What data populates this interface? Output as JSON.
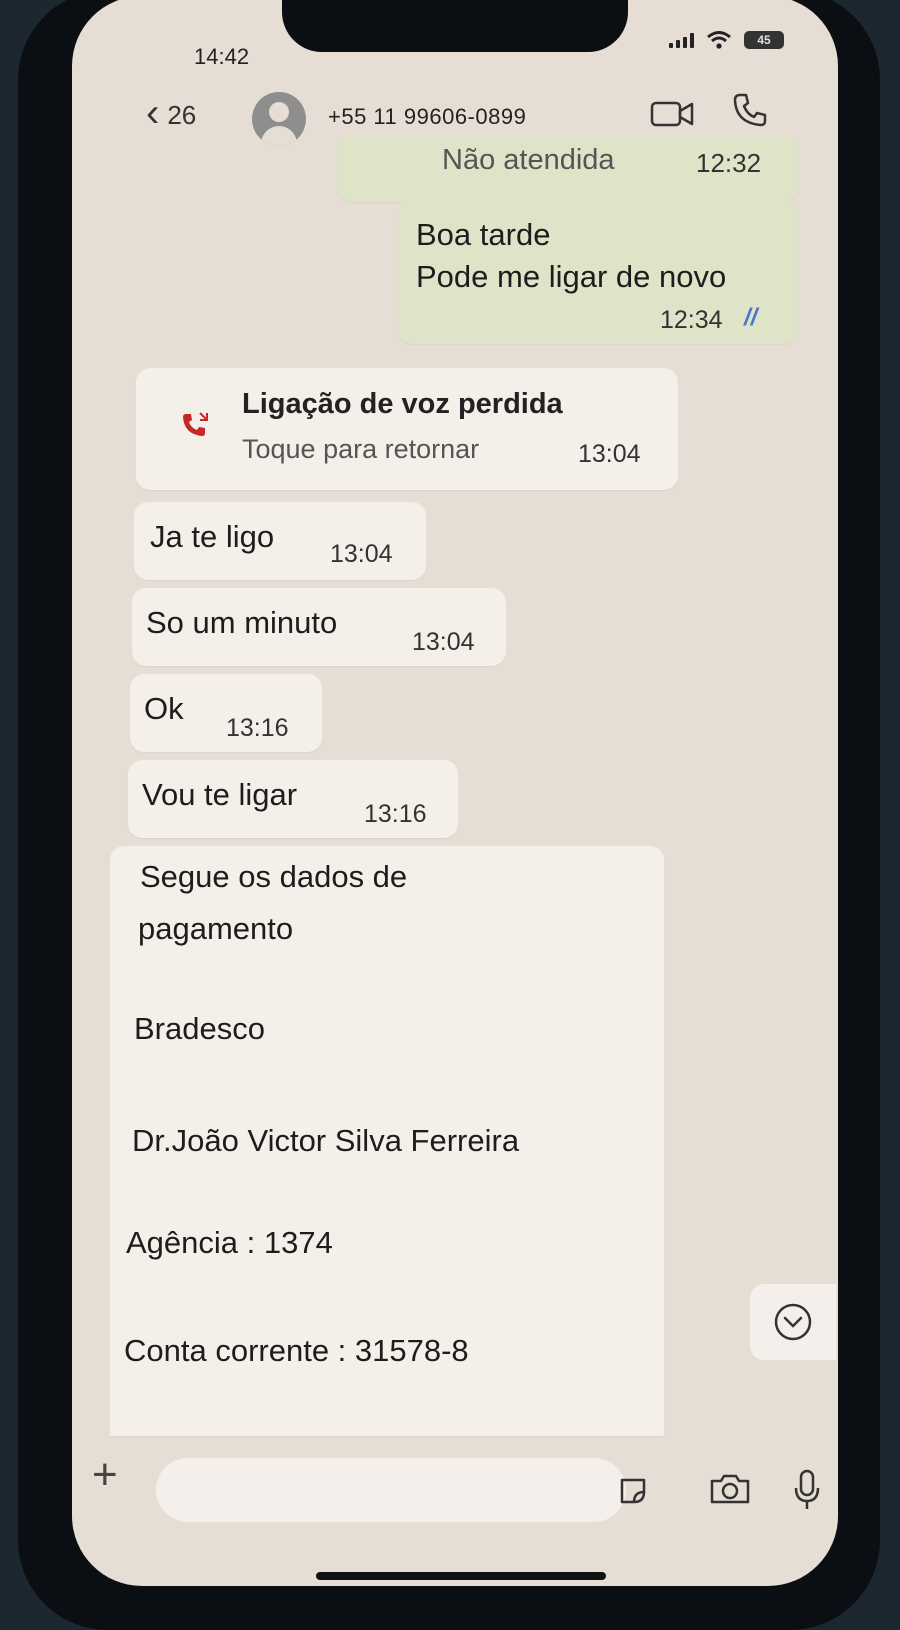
{
  "status_bar": {
    "time": "14:42",
    "battery": "45"
  },
  "header": {
    "back_count": "26",
    "contact": "+55 11 99606-0899"
  },
  "messages": {
    "call_missed_partial": {
      "text": "Não atendida",
      "time": "12:32"
    },
    "out_1": {
      "line1": "Boa tarde",
      "line2": "Pode me ligar de novo",
      "time": "12:34"
    },
    "missed_call": {
      "title": "Ligação de voz perdida",
      "subtitle": "Toque para retornar",
      "time": "13:04"
    },
    "in_1": {
      "text": "Ja te ligo",
      "time": "13:04"
    },
    "in_2": {
      "text": "So um minuto",
      "time": "13:04"
    },
    "in_3": {
      "text": "Ok",
      "time": "13:16"
    },
    "in_4": {
      "text": "Vou te ligar",
      "time": "13:16"
    },
    "in_5": {
      "line1": "Segue os dados de",
      "line2": "pagamento",
      "bank": "Bradesco",
      "name": "Dr.João Victor Silva Ferreira",
      "agency": "Agência : 1374",
      "account": "Conta corrente : 31578-8"
    }
  },
  "input": {
    "placeholder": ""
  },
  "colors": {
    "chat_bg": "#e6ddd4",
    "incoming": "#f5efe9",
    "outgoing": "#dfe4c9",
    "read_ticks": "#4f74c9",
    "missed_call_icon": "#c62828"
  }
}
